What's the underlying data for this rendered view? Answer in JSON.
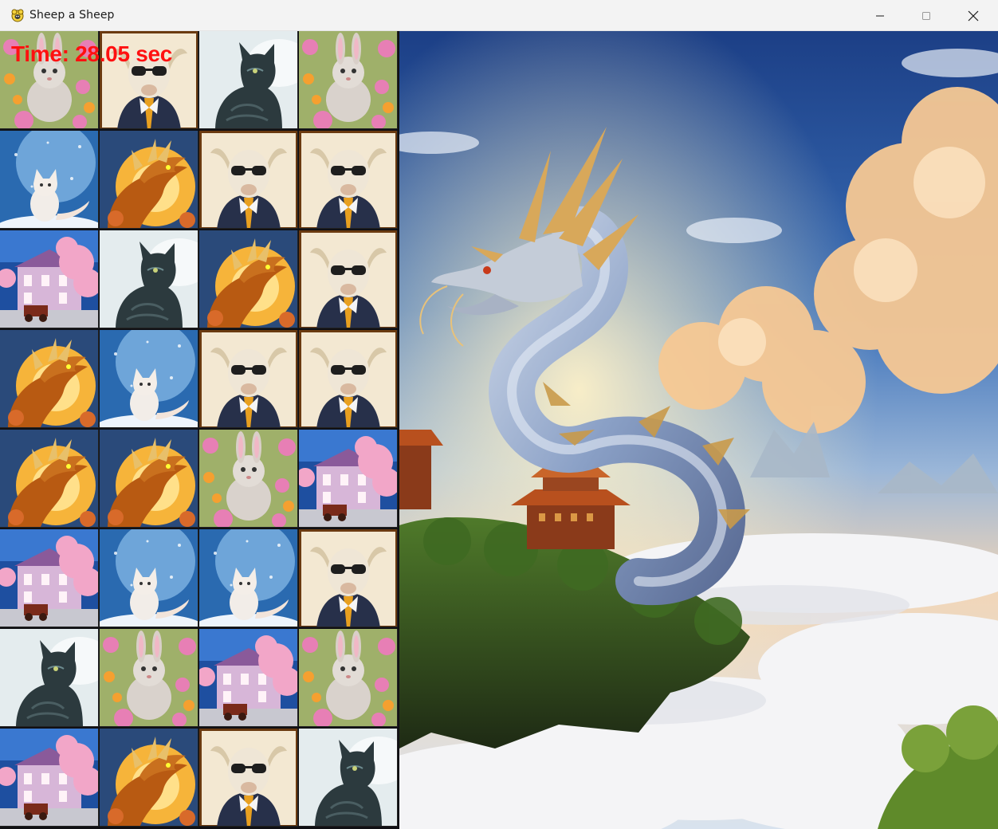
{
  "window": {
    "title": "Sheep a Sheep",
    "icon": "sheep-app-icon",
    "controls": [
      "minimize-icon",
      "maximize-icon",
      "close-icon"
    ]
  },
  "hud": {
    "timer_text": "Time: 28.05 sec"
  },
  "board": {
    "columns": 4,
    "rows": 8,
    "tiles": [
      [
        "rabbit",
        "goat",
        "cat",
        "rabbit"
      ],
      [
        "fox",
        "dragon",
        "goat",
        "goat"
      ],
      [
        "house",
        "cat",
        "dragon",
        "goat"
      ],
      [
        "dragon",
        "fox",
        "goat",
        "goat"
      ],
      [
        "dragon",
        "dragon",
        "rabbit",
        "house"
      ],
      [
        "house",
        "fox",
        "fox",
        "goat"
      ],
      [
        "cat",
        "rabbit",
        "house",
        "rabbit"
      ],
      [
        "house",
        "dragon",
        "goat",
        "cat"
      ]
    ]
  },
  "background": {
    "scene": "dragon-over-clouds-illustration"
  },
  "colors": {
    "timer": "#ff1010",
    "titlebar": "#f3f3f3"
  }
}
